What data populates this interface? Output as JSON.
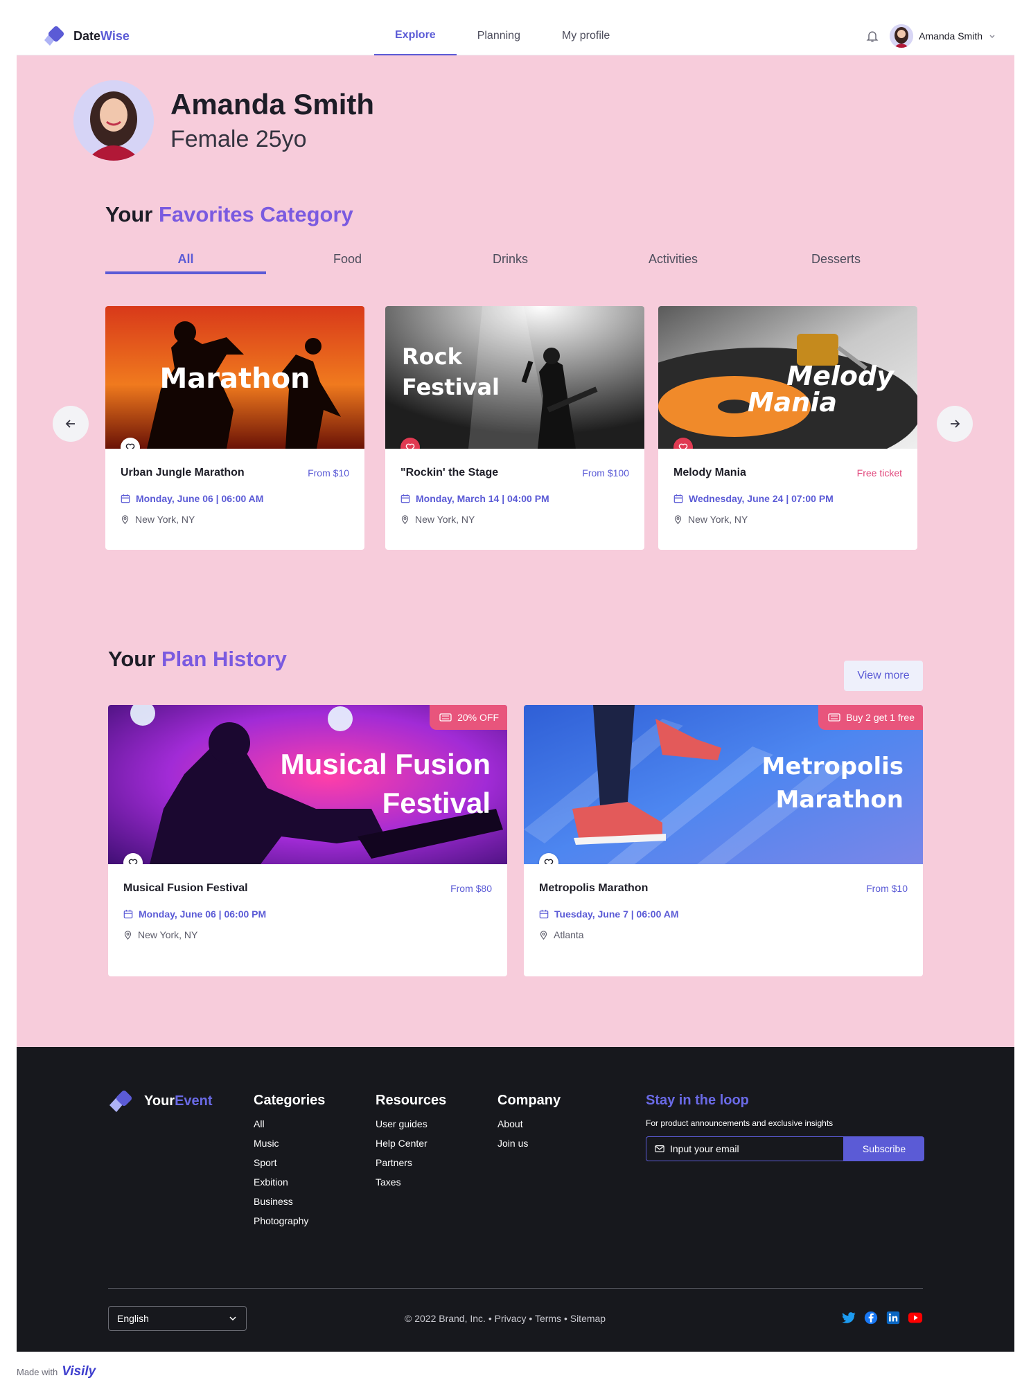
{
  "header": {
    "brand": {
      "part1": "Date",
      "part2": "Wise"
    },
    "nav": [
      "Explore",
      "Planning",
      "My profile"
    ],
    "active_nav": "Explore",
    "user_name": "Amanda Smith"
  },
  "profile": {
    "name": "Amanda Smith",
    "subtitle": "Female 25yo"
  },
  "favorites": {
    "title_part1": "Your",
    "title_part2": "Favorites Category",
    "tabs": [
      "All",
      "Food",
      "Drinks",
      "Activities",
      "Desserts"
    ],
    "active_tab": "All",
    "cards": [
      {
        "image_text": "Marathon",
        "title": "Urban Jungle Marathon",
        "price": "From $10",
        "date": "Monday, June 06 | 06:00 AM",
        "location": "New York, NY",
        "favorited": false
      },
      {
        "image_text_line1": "Rock",
        "image_text_line2": "Festival",
        "title": "\"Rockin' the Stage",
        "price": "From $100",
        "date": "Monday, March 14 | 04:00 PM",
        "location": "New York, NY",
        "favorited": true
      },
      {
        "image_text_line1": "Melody",
        "image_text_line2": "Mania",
        "title": "Melody Mania",
        "price": "Free ticket",
        "date": "Wednesday, June 24 | 07:00 PM",
        "location": "New York, NY",
        "favorited": true
      }
    ]
  },
  "history": {
    "title_part1": "Your",
    "title_part2": "Plan History",
    "view_more": "View more",
    "cards": [
      {
        "badge": "20% OFF",
        "image_text_line1": "Musical Fusion",
        "image_text_line2": "Festival",
        "title": "Musical Fusion Festival",
        "price": "From $80",
        "date": "Monday, June 06 | 06:00 PM",
        "location": "New York, NY"
      },
      {
        "badge": "Buy 2 get 1 free",
        "image_text_line1": "Metropolis",
        "image_text_line2": "Marathon",
        "title": "Metropolis Marathon",
        "price": "From $10",
        "date": "Tuesday, June 7 | 06:00 AM",
        "location": "Atlanta"
      }
    ]
  },
  "footer": {
    "brand": {
      "part1": "Your",
      "part2": "Event"
    },
    "categories": {
      "title": "Categories",
      "links": [
        "All",
        "Music",
        "Sport",
        "Exbition",
        "Business",
        "Photography"
      ]
    },
    "resources": {
      "title": "Resources",
      "links": [
        "User guides",
        "Help Center",
        "Partners",
        "Taxes"
      ]
    },
    "company": {
      "title": "Company",
      "links": [
        "About",
        "Join us"
      ]
    },
    "newsletter": {
      "title": "Stay in the loop",
      "text": "For product announcements and exclusive insights",
      "placeholder": "Input your email",
      "button": "Subscribe"
    },
    "language": "English",
    "copyright": "© 2022 Brand, Inc. • Privacy • Terms • Sitemap",
    "social": [
      "twitter-icon",
      "facebook-icon",
      "linkedin-icon",
      "youtube-icon"
    ]
  },
  "made_with": {
    "prefix": "Made with",
    "brand": "Visily"
  },
  "colors": {
    "accent": "#5b5bd6",
    "highlight": "#7a5ae0",
    "page_bg": "#f7ccdb",
    "footer_bg": "#17181d",
    "badge": "#e8557c",
    "favorite": "#e03a52"
  }
}
